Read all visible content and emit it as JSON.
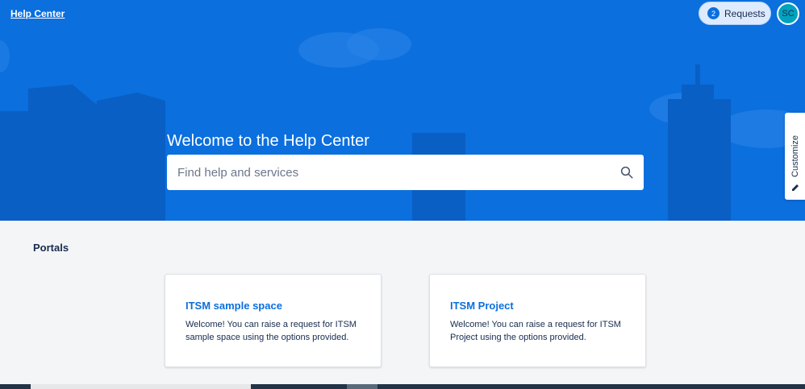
{
  "header": {
    "help_center_link": "Help Center",
    "requests": {
      "count": "2",
      "label": "Requests"
    },
    "avatar_initials": "SC"
  },
  "hero": {
    "welcome_title": "Welcome to the Help Center",
    "search": {
      "placeholder": "Find help and services",
      "value": ""
    }
  },
  "customize": {
    "label": "Customize"
  },
  "portals": {
    "title": "Portals",
    "cards": [
      {
        "title": "ITSM sample space",
        "description": "Welcome! You can raise a request for ITSM sample space using the options provided."
      },
      {
        "title": "ITSM Project",
        "description": "Welcome! You can raise a request for ITSM Project using the options provided."
      }
    ]
  },
  "colors": {
    "hero_blue": "#0b6fde",
    "link_blue": "#0b6fde",
    "page_bg": "#f4f5f7",
    "avatar_teal": "#00a3bf"
  }
}
